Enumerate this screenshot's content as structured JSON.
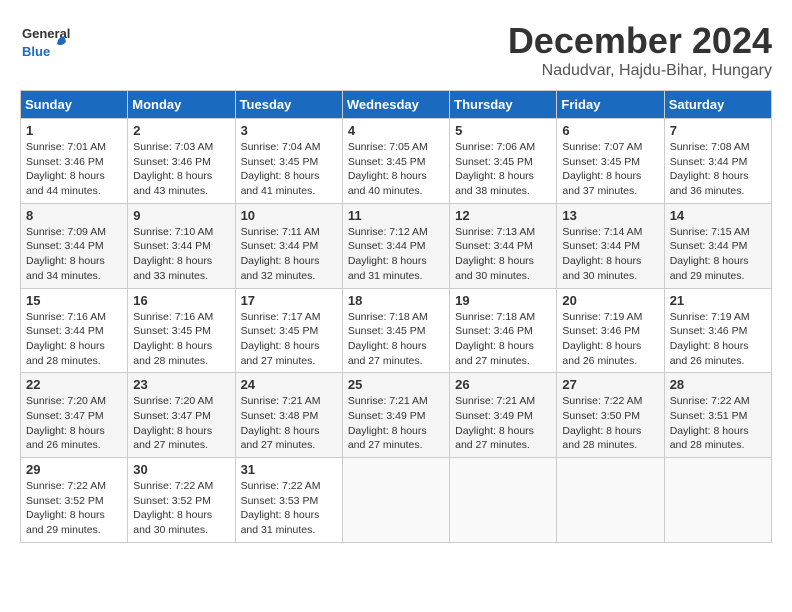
{
  "logo": {
    "general": "General",
    "blue": "Blue"
  },
  "title": "December 2024",
  "location": "Nadudvar, Hajdu-Bihar, Hungary",
  "days_of_week": [
    "Sunday",
    "Monday",
    "Tuesday",
    "Wednesday",
    "Thursday",
    "Friday",
    "Saturday"
  ],
  "weeks": [
    [
      {
        "day": "1",
        "sunrise": "7:01 AM",
        "sunset": "3:46 PM",
        "daylight": "8 hours and 44 minutes."
      },
      {
        "day": "2",
        "sunrise": "7:03 AM",
        "sunset": "3:46 PM",
        "daylight": "8 hours and 43 minutes."
      },
      {
        "day": "3",
        "sunrise": "7:04 AM",
        "sunset": "3:45 PM",
        "daylight": "8 hours and 41 minutes."
      },
      {
        "day": "4",
        "sunrise": "7:05 AM",
        "sunset": "3:45 PM",
        "daylight": "8 hours and 40 minutes."
      },
      {
        "day": "5",
        "sunrise": "7:06 AM",
        "sunset": "3:45 PM",
        "daylight": "8 hours and 38 minutes."
      },
      {
        "day": "6",
        "sunrise": "7:07 AM",
        "sunset": "3:45 PM",
        "daylight": "8 hours and 37 minutes."
      },
      {
        "day": "7",
        "sunrise": "7:08 AM",
        "sunset": "3:44 PM",
        "daylight": "8 hours and 36 minutes."
      }
    ],
    [
      {
        "day": "8",
        "sunrise": "7:09 AM",
        "sunset": "3:44 PM",
        "daylight": "8 hours and 34 minutes."
      },
      {
        "day": "9",
        "sunrise": "7:10 AM",
        "sunset": "3:44 PM",
        "daylight": "8 hours and 33 minutes."
      },
      {
        "day": "10",
        "sunrise": "7:11 AM",
        "sunset": "3:44 PM",
        "daylight": "8 hours and 32 minutes."
      },
      {
        "day": "11",
        "sunrise": "7:12 AM",
        "sunset": "3:44 PM",
        "daylight": "8 hours and 31 minutes."
      },
      {
        "day": "12",
        "sunrise": "7:13 AM",
        "sunset": "3:44 PM",
        "daylight": "8 hours and 30 minutes."
      },
      {
        "day": "13",
        "sunrise": "7:14 AM",
        "sunset": "3:44 PM",
        "daylight": "8 hours and 30 minutes."
      },
      {
        "day": "14",
        "sunrise": "7:15 AM",
        "sunset": "3:44 PM",
        "daylight": "8 hours and 29 minutes."
      }
    ],
    [
      {
        "day": "15",
        "sunrise": "7:16 AM",
        "sunset": "3:44 PM",
        "daylight": "8 hours and 28 minutes."
      },
      {
        "day": "16",
        "sunrise": "7:16 AM",
        "sunset": "3:45 PM",
        "daylight": "8 hours and 28 minutes."
      },
      {
        "day": "17",
        "sunrise": "7:17 AM",
        "sunset": "3:45 PM",
        "daylight": "8 hours and 27 minutes."
      },
      {
        "day": "18",
        "sunrise": "7:18 AM",
        "sunset": "3:45 PM",
        "daylight": "8 hours and 27 minutes."
      },
      {
        "day": "19",
        "sunrise": "7:18 AM",
        "sunset": "3:46 PM",
        "daylight": "8 hours and 27 minutes."
      },
      {
        "day": "20",
        "sunrise": "7:19 AM",
        "sunset": "3:46 PM",
        "daylight": "8 hours and 26 minutes."
      },
      {
        "day": "21",
        "sunrise": "7:19 AM",
        "sunset": "3:46 PM",
        "daylight": "8 hours and 26 minutes."
      }
    ],
    [
      {
        "day": "22",
        "sunrise": "7:20 AM",
        "sunset": "3:47 PM",
        "daylight": "8 hours and 26 minutes."
      },
      {
        "day": "23",
        "sunrise": "7:20 AM",
        "sunset": "3:47 PM",
        "daylight": "8 hours and 27 minutes."
      },
      {
        "day": "24",
        "sunrise": "7:21 AM",
        "sunset": "3:48 PM",
        "daylight": "8 hours and 27 minutes."
      },
      {
        "day": "25",
        "sunrise": "7:21 AM",
        "sunset": "3:49 PM",
        "daylight": "8 hours and 27 minutes."
      },
      {
        "day": "26",
        "sunrise": "7:21 AM",
        "sunset": "3:49 PM",
        "daylight": "8 hours and 27 minutes."
      },
      {
        "day": "27",
        "sunrise": "7:22 AM",
        "sunset": "3:50 PM",
        "daylight": "8 hours and 28 minutes."
      },
      {
        "day": "28",
        "sunrise": "7:22 AM",
        "sunset": "3:51 PM",
        "daylight": "8 hours and 28 minutes."
      }
    ],
    [
      {
        "day": "29",
        "sunrise": "7:22 AM",
        "sunset": "3:52 PM",
        "daylight": "8 hours and 29 minutes."
      },
      {
        "day": "30",
        "sunrise": "7:22 AM",
        "sunset": "3:52 PM",
        "daylight": "8 hours and 30 minutes."
      },
      {
        "day": "31",
        "sunrise": "7:22 AM",
        "sunset": "3:53 PM",
        "daylight": "8 hours and 31 minutes."
      },
      null,
      null,
      null,
      null
    ]
  ],
  "labels": {
    "sunrise": "Sunrise:",
    "sunset": "Sunset:",
    "daylight": "Daylight:"
  }
}
